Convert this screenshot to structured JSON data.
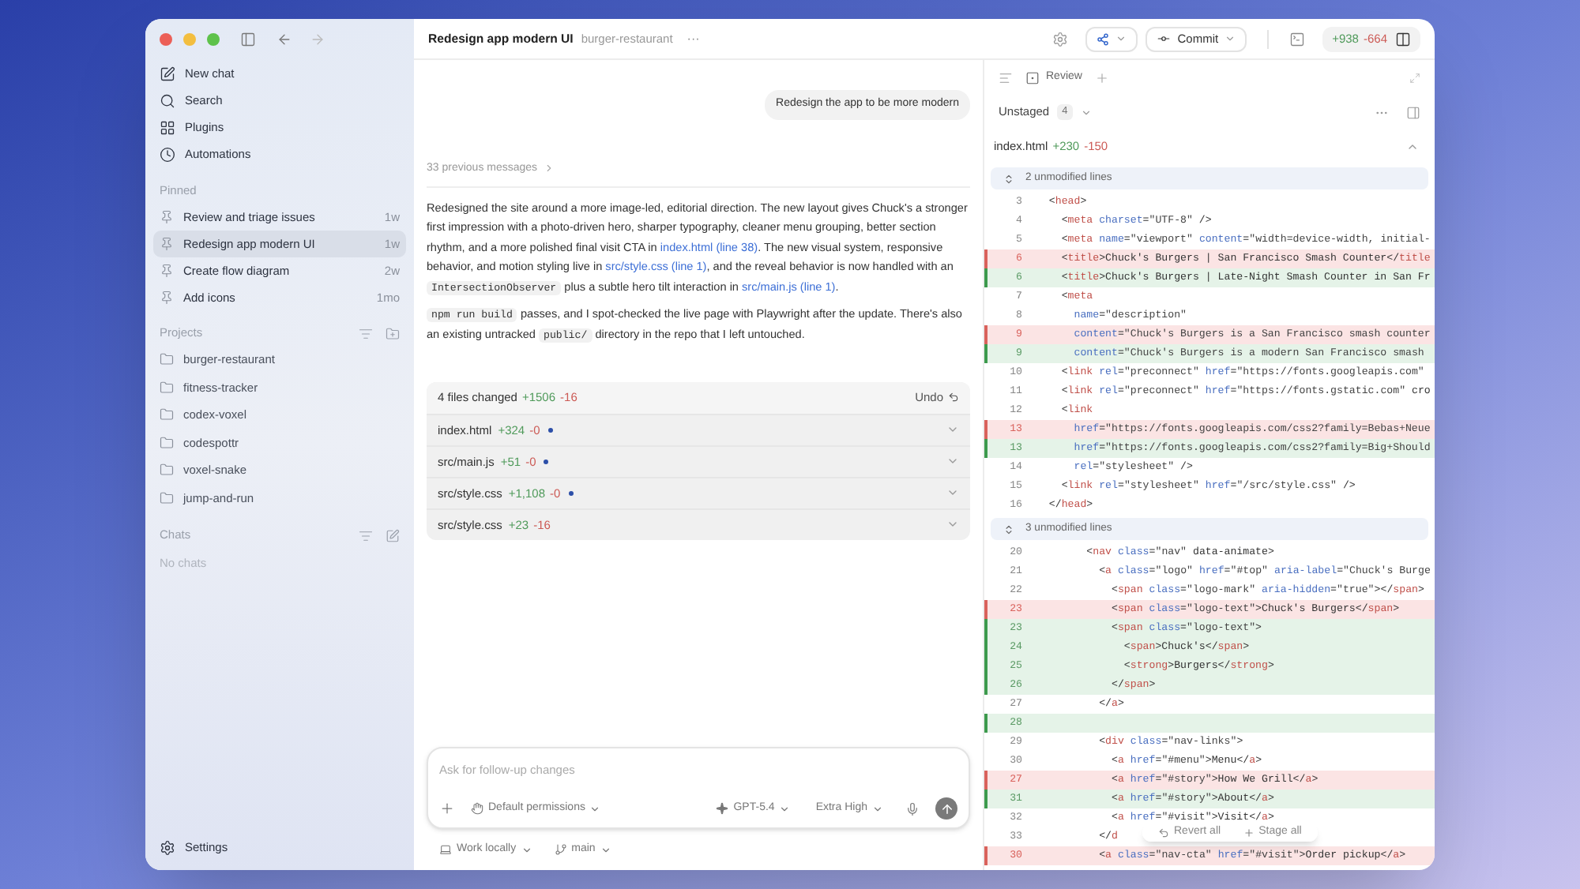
{
  "sidebar": {
    "nav": [
      {
        "kind": "new-chat",
        "label": "New chat"
      },
      {
        "kind": "search",
        "label": "Search"
      },
      {
        "kind": "plugins",
        "label": "Plugins"
      },
      {
        "kind": "automations",
        "label": "Automations"
      }
    ],
    "pinned": {
      "title": "Pinned",
      "items": [
        {
          "label": "Review and triage issues",
          "time": "1w",
          "selected": false
        },
        {
          "label": "Redesign app modern UI",
          "time": "1w",
          "selected": true
        },
        {
          "label": "Create flow diagram",
          "time": "2w",
          "selected": false
        },
        {
          "label": "Add icons",
          "time": "1mo",
          "selected": false
        }
      ]
    },
    "projects": {
      "title": "Projects",
      "items": [
        "burger-restaurant",
        "fitness-tracker",
        "codex-voxel",
        "codespottr",
        "voxel-snake",
        "jump-and-run"
      ]
    },
    "chats": {
      "title": "Chats",
      "empty": "No chats"
    },
    "settings": "Settings"
  },
  "header": {
    "title": "Redesign app modern UI",
    "project": "burger-restaurant",
    "more": "···",
    "commit": "Commit",
    "added": "+938",
    "removed": "-664"
  },
  "chat": {
    "user_message": "Redesign the app to be more modern",
    "previous": "33 previous messages",
    "paragraphs": [
      [
        {
          "kind": "text",
          "text": "Redesigned the site around a more image-led, editorial direction. The new layout gives Chuck's a stronger first impression with a photo-driven hero, sharper typography, cleaner menu grouping, better section rhythm, and a more polished final visit CTA in "
        },
        {
          "kind": "link",
          "text": "index.html (line 38)"
        },
        {
          "kind": "text",
          "text": ". The new visual system, responsive behavior, and motion styling live in "
        },
        {
          "kind": "link",
          "text": "src/style.css (line 1)"
        },
        {
          "kind": "text",
          "text": ", and the reveal behavior is now handled with an "
        },
        {
          "kind": "code",
          "text": "IntersectionObserver"
        },
        {
          "kind": "text",
          "text": " plus a subtle hero tilt interaction in "
        },
        {
          "kind": "link",
          "text": "src/main.js (line 1)"
        },
        {
          "kind": "text",
          "text": "."
        }
      ],
      [
        {
          "kind": "code",
          "text": "npm run build"
        },
        {
          "kind": "text",
          "text": " passes, and I spot-checked the live page with Playwright after the update. There's also an existing untracked "
        },
        {
          "kind": "code",
          "text": "public/"
        },
        {
          "kind": "text",
          "text": " directory in the repo that I left untouched."
        }
      ]
    ],
    "changes": {
      "summary": "4 files changed",
      "added": "+1506",
      "removed": "-16",
      "undo": "Undo",
      "files": [
        {
          "name": "index.html",
          "added": "+324",
          "removed": "-0",
          "marked": true
        },
        {
          "name": "src/main.js",
          "added": "+51",
          "removed": "-0",
          "marked": true
        },
        {
          "name": "src/style.css",
          "added": "+1,108",
          "removed": "-0",
          "marked": true
        },
        {
          "name": "src/style.css",
          "added": "+23",
          "removed": "-16",
          "marked": false
        }
      ]
    },
    "composer": {
      "placeholder": "Ask for follow-up changes",
      "permissions": "Default permissions",
      "model": "GPT-5.4",
      "effort": "Extra High"
    },
    "footer": {
      "environment": "Work locally",
      "branch": "main"
    }
  },
  "review": {
    "tab": "Review",
    "stage": "Unstaged",
    "count": "4",
    "file": {
      "name": "index.html",
      "added": "+230",
      "removed": "-150"
    },
    "lines": [
      {
        "kind": "fold",
        "text": "2 unmodified lines"
      },
      {
        "kind": "context",
        "num": "3",
        "text": "  <head>"
      },
      {
        "kind": "context",
        "num": "4",
        "text": "    <meta charset=\"UTF-8\" />"
      },
      {
        "kind": "context",
        "num": "5",
        "text": "    <meta name=\"viewport\" content=\"width=device-width, initial-"
      },
      {
        "kind": "removed",
        "num": "6",
        "text": "    <title>Chuck's Burgers | San Francisco Smash Counter</title"
      },
      {
        "kind": "added",
        "num": "6",
        "text": "    <title>Chuck's Burgers | Late-Night Smash Counter in San Fr"
      },
      {
        "kind": "context",
        "num": "7",
        "text": "    <meta"
      },
      {
        "kind": "context",
        "num": "8",
        "text": "      name=\"description\""
      },
      {
        "kind": "removed",
        "num": "9",
        "text": "      content=\"Chuck's Burgers is a San Francisco smash counter"
      },
      {
        "kind": "added",
        "num": "9",
        "text": "      content=\"Chuck's Burgers is a modern San Francisco smash"
      },
      {
        "kind": "context",
        "num": "10",
        "text": "    <link rel=\"preconnect\" href=\"https://fonts.googleapis.com\""
      },
      {
        "kind": "context",
        "num": "11",
        "text": "    <link rel=\"preconnect\" href=\"https://fonts.gstatic.com\" cro"
      },
      {
        "kind": "context",
        "num": "12",
        "text": "    <link"
      },
      {
        "kind": "removed",
        "num": "13",
        "text": "      href=\"https://fonts.googleapis.com/css2?family=Bebas+Neue"
      },
      {
        "kind": "added",
        "num": "13",
        "text": "      href=\"https://fonts.googleapis.com/css2?family=Big+Should"
      },
      {
        "kind": "context",
        "num": "14",
        "text": "      rel=\"stylesheet\" />"
      },
      {
        "kind": "context",
        "num": "15",
        "text": "    <link rel=\"stylesheet\" href=\"/src/style.css\" />"
      },
      {
        "kind": "context",
        "num": "16",
        "text": "  </head>"
      },
      {
        "kind": "fold",
        "text": "3 unmodified lines"
      },
      {
        "kind": "context",
        "num": "20",
        "text": "        <nav class=\"nav\" data-animate>"
      },
      {
        "kind": "context",
        "num": "21",
        "text": "          <a class=\"logo\" href=\"#top\" aria-label=\"Chuck's Burge"
      },
      {
        "kind": "context",
        "num": "22",
        "text": "            <span class=\"logo-mark\" aria-hidden=\"true\"></span>"
      },
      {
        "kind": "removed",
        "num": "23",
        "text": "            <span class=\"logo-text\">Chuck's Burgers</span>"
      },
      {
        "kind": "added",
        "num": "23",
        "text": "            <span class=\"logo-text\">"
      },
      {
        "kind": "added",
        "num": "24",
        "text": "              <span>Chuck's</span>"
      },
      {
        "kind": "added",
        "num": "25",
        "text": "              <strong>Burgers</strong>"
      },
      {
        "kind": "added",
        "num": "26",
        "text": "            </span>"
      },
      {
        "kind": "context",
        "num": "27",
        "text": "          </a>"
      },
      {
        "kind": "added",
        "num": "28"
      },
      {
        "kind": "context",
        "num": "29",
        "text": "          <div class=\"nav-links\">"
      },
      {
        "kind": "context",
        "num": "30",
        "text": "            <a href=\"#menu\">Menu</a>"
      },
      {
        "kind": "removed",
        "num": "27",
        "text": "            <a href=\"#story\">How We Grill</a>"
      },
      {
        "kind": "added",
        "num": "31",
        "text": "            <a href=\"#story\">About</a>"
      },
      {
        "kind": "context",
        "num": "32",
        "text": "            <a href=\"#visit\">Visit</a>"
      },
      {
        "kind": "context",
        "num": "33",
        "text": "          </d"
      },
      {
        "kind": "removed",
        "num": "30",
        "text": "          <a class=\"nav-cta\" href=\"#visit\">Order pickup</a>"
      }
    ],
    "actions": {
      "revert": "Revert all",
      "stage": "Stage all"
    }
  }
}
